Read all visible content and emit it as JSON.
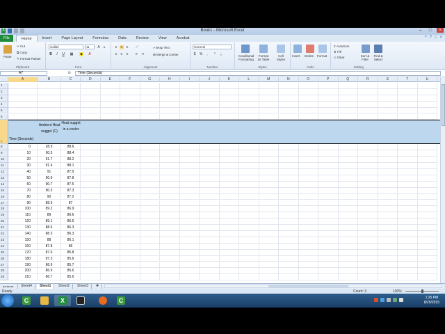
{
  "window": {
    "title": "Book1 - Microsoft Excel"
  },
  "ribbon": {
    "file_tab": "File",
    "tabs": [
      "Home",
      "Insert",
      "Page Layout",
      "Formulas",
      "Data",
      "Review",
      "View",
      "Acrobat"
    ],
    "active_tab": "Home",
    "clipboard": {
      "paste": "Paste",
      "cut": "Cut",
      "copy": "Copy",
      "format_painter": "Format Painter",
      "label": "Clipboard"
    },
    "font": {
      "name": "Calibri",
      "size": "11",
      "label": "Font"
    },
    "alignment": {
      "wrap_text": "Wrap Text",
      "merge_center": "Merge & Center",
      "label": "Alignment"
    },
    "number": {
      "format": "General",
      "label": "Number"
    },
    "styles": {
      "conditional": "Conditional Formatting",
      "format_table": "Format as Table",
      "cell_styles": "Cell Styles",
      "label": "Styles"
    },
    "cells": {
      "insert": "Insert",
      "delete": "Delete",
      "format": "Format",
      "label": "Cells"
    },
    "editing": {
      "autosum": "AutoSum",
      "fill": "Fill",
      "clear": "Clear",
      "sort_filter": "Sort & Filter",
      "find_select": "Find & Select",
      "label": "Editing"
    }
  },
  "formula_bar": {
    "name_box": "A7",
    "fx": "fx",
    "content": "Time (Seconds)"
  },
  "grid": {
    "columns": [
      "A",
      "B",
      "C",
      "D",
      "E",
      "F",
      "G",
      "H",
      "I",
      "J",
      "K",
      "L",
      "M",
      "N",
      "O",
      "P",
      "Q",
      "R",
      "S",
      "T",
      "U"
    ],
    "selected_column": "A",
    "selected_row": "7",
    "header_row": {
      "row_number": "7",
      "a": "Time (Seconds)",
      "b": "Ambient Heat nugget (C)",
      "c": "Heat nugget in a cooler"
    },
    "blank_rows": [
      "1",
      "2",
      "3",
      "4",
      "5",
      "6"
    ],
    "rows": [
      {
        "n": "8",
        "a": "0",
        "b": "28.9",
        "c": "88.6"
      },
      {
        "n": "9",
        "a": "10",
        "b": "90.5",
        "c": "88.4"
      },
      {
        "n": "10",
        "a": "20",
        "b": "91.7",
        "c": "88.2"
      },
      {
        "n": "11",
        "a": "30",
        "b": "91.4",
        "c": "88.1"
      },
      {
        "n": "12",
        "a": "40",
        "b": "91",
        "c": "87.9"
      },
      {
        "n": "13",
        "a": "50",
        "b": "90.9",
        "c": "87.8"
      },
      {
        "n": "14",
        "a": "60",
        "b": "90.7",
        "c": "87.5"
      },
      {
        "n": "15",
        "a": "70",
        "b": "90.3",
        "c": "87.3"
      },
      {
        "n": "16",
        "a": "80",
        "b": "90",
        "c": "87.2"
      },
      {
        "n": "17",
        "a": "90",
        "b": "89.6",
        "c": "87"
      },
      {
        "n": "18",
        "a": "100",
        "b": "89.2",
        "c": "86.9"
      },
      {
        "n": "19",
        "a": "110",
        "b": "89",
        "c": "86.6"
      },
      {
        "n": "20",
        "a": "120",
        "b": "89.1",
        "c": "86.5"
      },
      {
        "n": "21",
        "a": "130",
        "b": "88.6",
        "c": "86.3"
      },
      {
        "n": "22",
        "a": "140",
        "b": "88.3",
        "c": "86.3"
      },
      {
        "n": "23",
        "a": "150",
        "b": "88",
        "c": "86.1"
      },
      {
        "n": "24",
        "a": "160",
        "b": "87.8",
        "c": "86"
      },
      {
        "n": "25",
        "a": "170",
        "b": "87.6",
        "c": "85.8"
      },
      {
        "n": "26",
        "a": "180",
        "b": "87.3",
        "c": "85.6"
      },
      {
        "n": "27",
        "a": "190",
        "b": "86.9",
        "c": "85.7"
      },
      {
        "n": "28",
        "a": "200",
        "b": "86.9",
        "c": "85.6"
      },
      {
        "n": "29",
        "a": "210",
        "b": "86.7",
        "c": "85.6"
      }
    ]
  },
  "sheets": {
    "tabs": [
      "Sheet4",
      "Sheet1",
      "Sheet2",
      "Sheet3"
    ],
    "active": "Sheet1"
  },
  "status_bar": {
    "ready": "Ready",
    "count": "Count: 3",
    "zoom": "100%"
  },
  "taskbar": {
    "time": "1:25 PM",
    "date": "8/25/2015"
  },
  "colors": {
    "header_fill": "#bdd7ee",
    "file_tab": "#1f8c3b",
    "selection": "#f8d88a",
    "taskbar": "#1b3f66"
  }
}
